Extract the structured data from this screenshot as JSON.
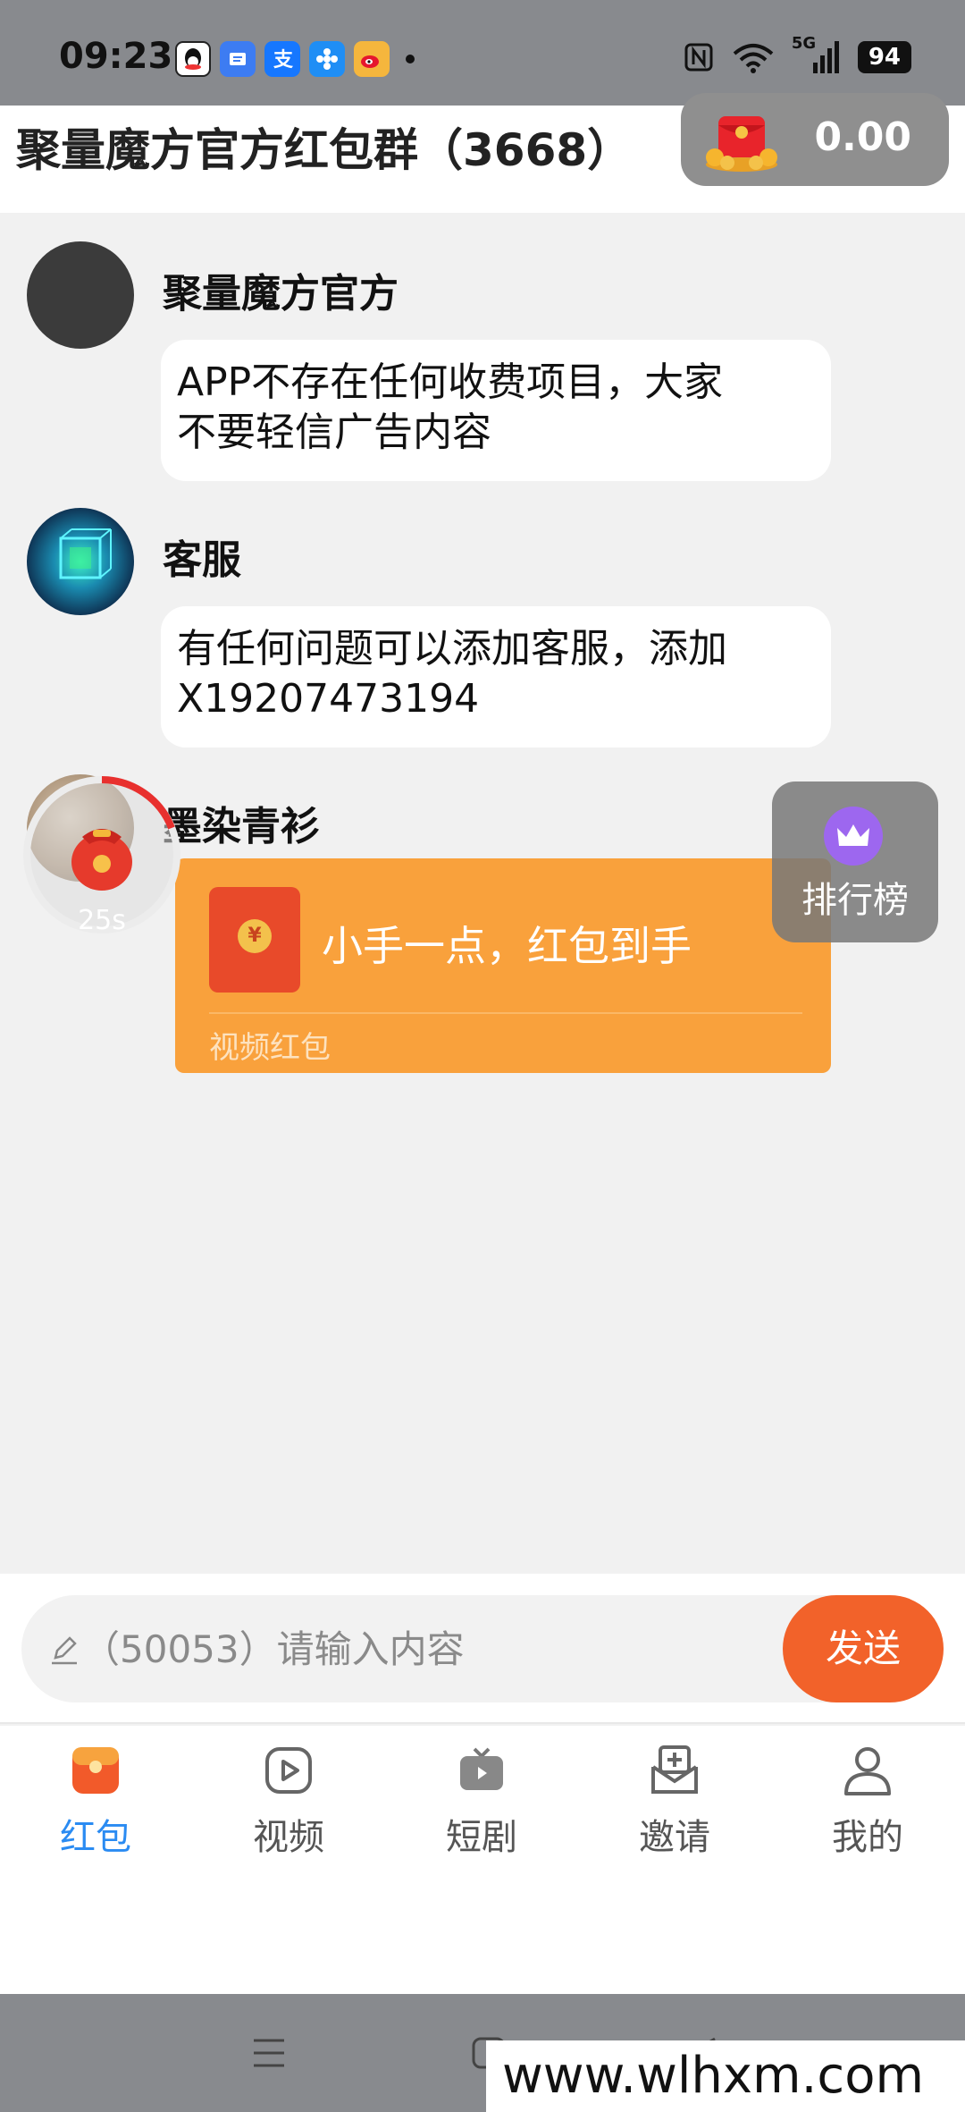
{
  "status_bar": {
    "time": "09:23",
    "network": "5G",
    "battery": "94"
  },
  "header": {
    "title": "聚量魔方官方红包群（3668）",
    "balance": "0.00"
  },
  "messages": [
    {
      "name": "聚量魔方官方",
      "text_line1": "APP不存在任何收费项目，大家",
      "text_line2": "不要轻信广告内容"
    },
    {
      "name": "客服",
      "text_line1": "有任何问题可以添加客服，添加",
      "text_line2": "X19207473194"
    },
    {
      "name": "墨染青衫"
    }
  ],
  "red_packet": {
    "message": "小手一点，红包到手",
    "type_label": "视频红包",
    "coin_symbol": "¥"
  },
  "timer": {
    "label": "25s"
  },
  "ranking": {
    "label": "排行榜"
  },
  "input": {
    "placeholder": "（50053）请输入内容",
    "send_label": "发送"
  },
  "tabs": [
    {
      "label": "红包",
      "icon": "red-packet-icon",
      "active": true
    },
    {
      "label": "视频",
      "icon": "video-icon"
    },
    {
      "label": "短剧",
      "icon": "tv-icon"
    },
    {
      "label": "邀请",
      "icon": "invite-icon"
    },
    {
      "label": "我的",
      "icon": "user-icon"
    }
  ],
  "watermark": "www.wlhxm.com",
  "colors": {
    "accent_orange": "#f2622a",
    "packet_orange": "#f9a13c",
    "active_tab": "#2a8bf2"
  }
}
